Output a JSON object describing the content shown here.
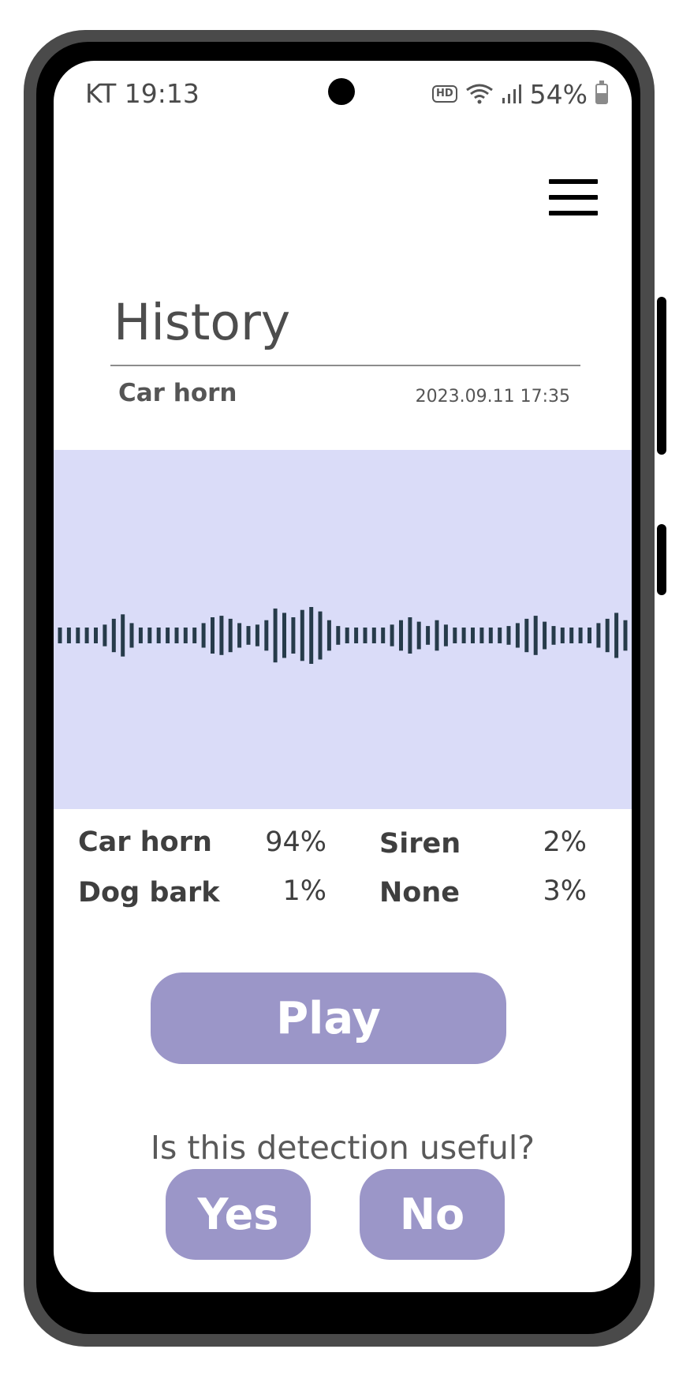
{
  "status_bar": {
    "carrier_time": "KT 19:13",
    "hd_label": "HD",
    "battery": "54%",
    "battery_level": 0.54
  },
  "header": {
    "menu_icon": "hamburger-menu-icon",
    "title": "History"
  },
  "detection": {
    "label": "Car horn",
    "timestamp": "2023.09.11  17:35"
  },
  "waveform": {
    "color": "#263b4a",
    "background": "#dadcf8",
    "bar_levels": [
      0.3,
      0.3,
      0.3,
      0.3,
      0.3,
      0.4,
      0.6,
      0.75,
      0.45,
      0.3,
      0.3,
      0.3,
      0.3,
      0.3,
      0.3,
      0.3,
      0.45,
      0.65,
      0.7,
      0.6,
      0.45,
      0.35,
      0.4,
      0.55,
      0.95,
      0.8,
      0.65,
      0.9,
      1.0,
      0.85,
      0.55,
      0.35,
      0.3,
      0.3,
      0.3,
      0.3,
      0.3,
      0.4,
      0.55,
      0.65,
      0.5,
      0.35,
      0.55,
      0.4,
      0.3,
      0.3,
      0.3,
      0.3,
      0.3,
      0.3,
      0.35,
      0.45,
      0.6,
      0.7,
      0.5,
      0.35,
      0.3,
      0.3,
      0.3,
      0.3,
      0.45,
      0.6,
      0.8,
      0.55
    ]
  },
  "results": [
    {
      "name": "Car horn",
      "value": "94%"
    },
    {
      "name": "Siren",
      "value": "2%"
    },
    {
      "name": "Dog bark",
      "value": "1%"
    },
    {
      "name": "None",
      "value": "3%"
    }
  ],
  "actions": {
    "play_label": "Play",
    "question": "Is this detection useful?",
    "yes_label": "Yes",
    "no_label": "No"
  },
  "colors": {
    "accent": "#9b96c8",
    "panel": "#dadcf8",
    "text": "#4d4d4d"
  }
}
